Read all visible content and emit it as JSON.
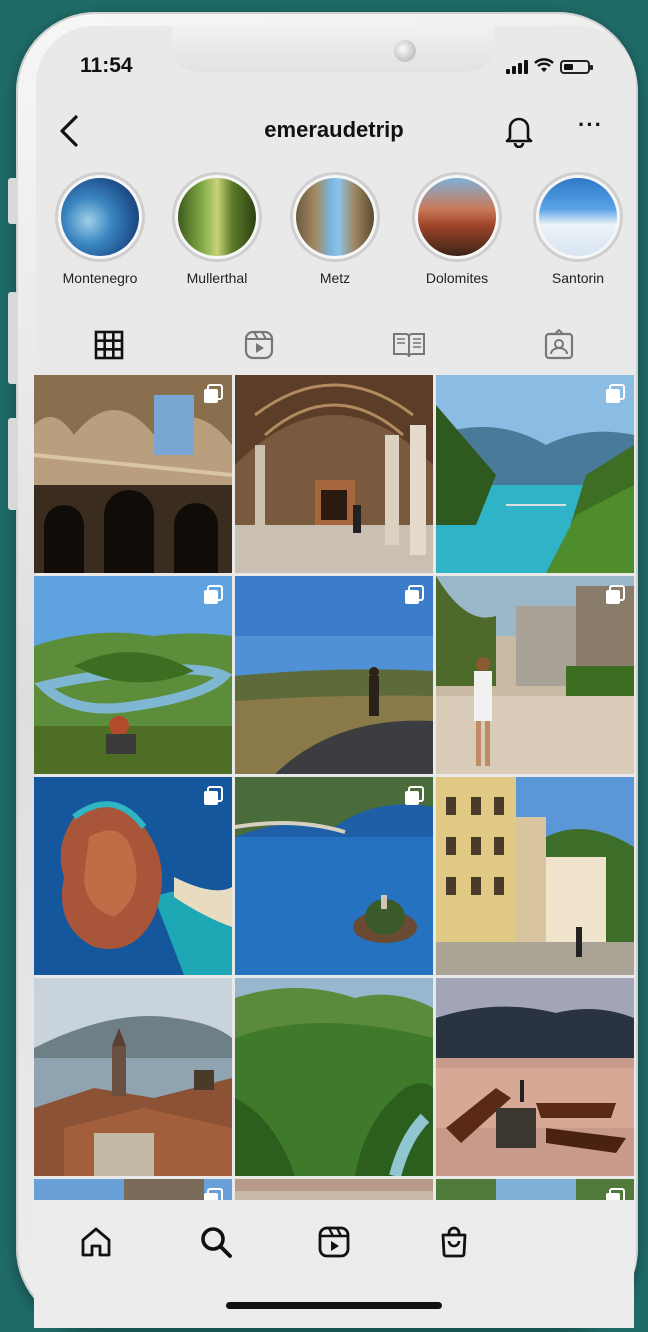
{
  "status_bar": {
    "time": "11:54"
  },
  "header": {
    "username": "emeraudetrip"
  },
  "highlights": [
    {
      "label": "Montenegro"
    },
    {
      "label": "Mullerthal"
    },
    {
      "label": "Metz"
    },
    {
      "label": "Dolomites"
    },
    {
      "label": "Santorin"
    }
  ],
  "tabs": [
    "grid-icon",
    "reels-icon",
    "guides-icon",
    "tagged-icon"
  ],
  "bottom_nav": [
    "home-icon",
    "search-icon",
    "reels-icon",
    "shop-icon"
  ],
  "colors": {
    "background": "#1f6b68",
    "text": "#111111",
    "screen": "#e9e9e9"
  }
}
